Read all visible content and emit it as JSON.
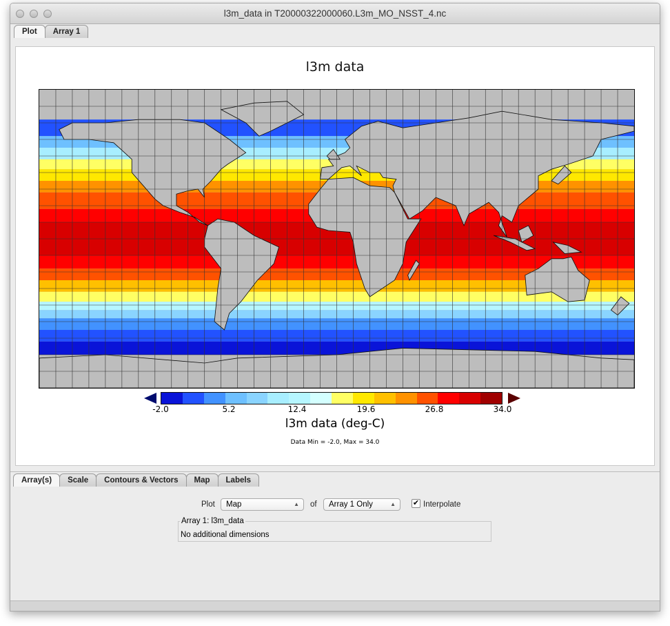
{
  "window": {
    "title": "l3m_data in T20000322000060.L3m_MO_NSST_4.nc"
  },
  "top_tabs": [
    {
      "label": "Plot",
      "active": true
    },
    {
      "label": "Array 1",
      "active": false
    }
  ],
  "plot": {
    "title": "l3m data",
    "colorbar": {
      "label": "l3m data (deg-C)",
      "ticks": [
        "-2.0",
        "5.2",
        "12.4",
        "19.6",
        "26.8",
        "34.0"
      ],
      "colors": [
        "#0a14d8",
        "#2252ff",
        "#4292ff",
        "#6ec0ff",
        "#8ad4ff",
        "#a8eeff",
        "#b6f6ff",
        "#d4ffff",
        "#ffff64",
        "#ffe800",
        "#ffc000",
        "#ff9200",
        "#ff5200",
        "#ff0000",
        "#d80000",
        "#a00000"
      ],
      "under_color": "#000c6e",
      "over_color": "#5a0000"
    },
    "data_range": "Data Min = -2.0, Max = 34.0"
  },
  "chart_data": {
    "type": "heatmap",
    "title": "l3m data",
    "colorbar_label": "l3m data (deg-C)",
    "range": [
      -2.0,
      34.0
    ],
    "grid": true,
    "projection": "equirectangular global map"
  },
  "bottom_tabs": [
    {
      "label": "Array(s)",
      "active": true
    },
    {
      "label": "Scale"
    },
    {
      "label": "Contours & Vectors"
    },
    {
      "label": "Map"
    },
    {
      "label": "Labels"
    }
  ],
  "controls": {
    "plot_label": "Plot",
    "plot_value": "Map",
    "of_label": "of",
    "array_value": "Array 1 Only",
    "interpolate_label": "Interpolate",
    "interpolate_checked": true,
    "group_title": "Array 1: l3m_data",
    "group_text": "No additional dimensions"
  }
}
